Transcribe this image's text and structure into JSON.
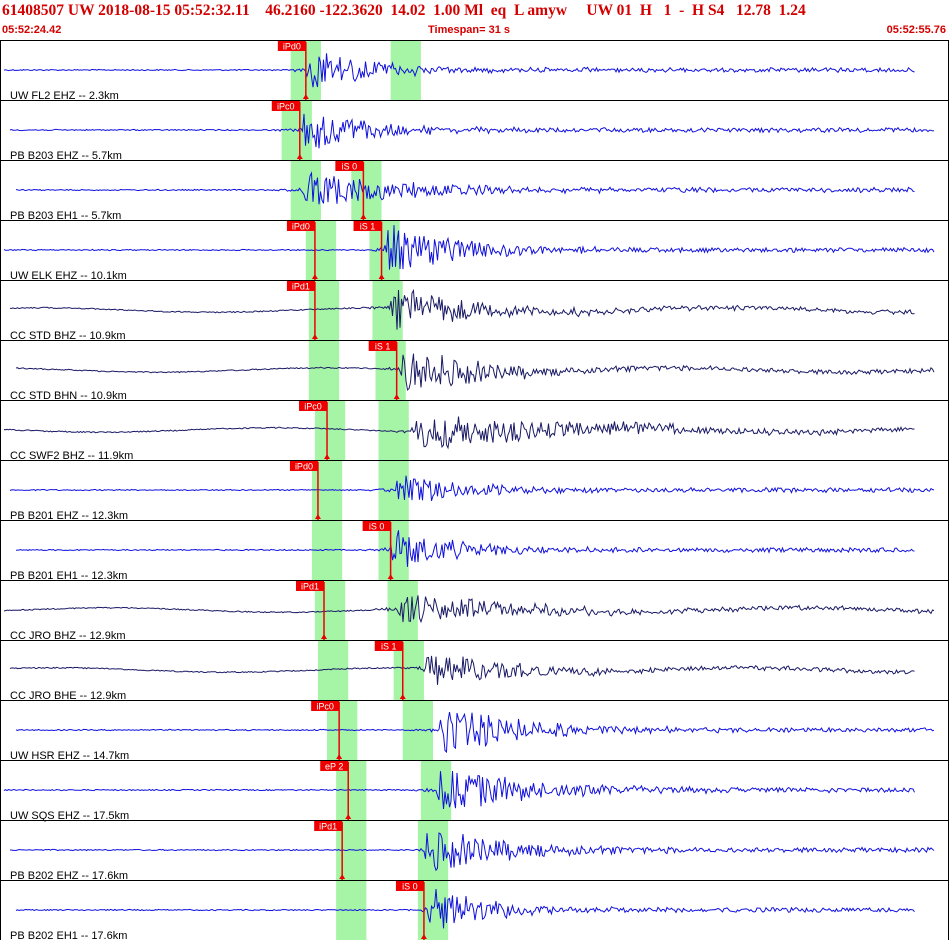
{
  "header": {
    "title": "61408507 UW 2018-08-15 05:52:32.11    46.2160 -122.3620  14.02  1.00 Ml  eq  L amyw     UW 01  H   1  -  H S4   12.78  1.24",
    "start_time": "05:52:24.42",
    "timespan": "Timespan=  31 s",
    "end_time": "05:52:55.76"
  },
  "colors": {
    "blue_trace": "#1010dd",
    "dark_trace": "#1a1a66",
    "pick": "#ee0000",
    "window": "#a6f5a6",
    "panel_border": "#000000"
  },
  "panels": [
    {
      "label": "UW FL2 EHZ -- 2.3km",
      "color": "blue",
      "picks": [
        {
          "label": "iPd0",
          "t": 10.1
        }
      ],
      "windows": [
        [
          9.6,
          10.6
        ],
        [
          12.9,
          13.9
        ]
      ],
      "amp": 1.0,
      "sig": [
        10.1,
        0.35
      ]
    },
    {
      "label": "PB B203 EHZ -- 5.7km",
      "color": "blue",
      "picks": [
        {
          "label": "iPc0",
          "t": 9.9
        }
      ],
      "windows": [
        [
          9.3,
          10.3
        ]
      ],
      "amp": 0.9,
      "sig": [
        9.9,
        0.5
      ]
    },
    {
      "label": "PB B203 EH1 -- 5.7km",
      "color": "blue",
      "picks": [
        {
          "label": "iS 0",
          "t": 12.0
        }
      ],
      "windows": [
        [
          9.6,
          10.6
        ],
        [
          11.6,
          12.6
        ]
      ],
      "amp": 0.8,
      "sig": [
        10.0,
        0.8
      ]
    },
    {
      "label": "UW ELK EHZ -- 10.1km",
      "color": "blue",
      "picks": [
        {
          "label": "iPd0",
          "t": 10.4
        },
        {
          "label": "iS 1",
          "t": 12.6
        }
      ],
      "windows": [
        [
          10.1,
          11.1
        ],
        [
          12.2,
          13.2
        ]
      ],
      "amp": 1.0,
      "sig": [
        12.7,
        0.6
      ]
    },
    {
      "label": "CC STD BHZ -- 10.9km",
      "color": "dark",
      "picks": [
        {
          "label": "iPd1",
          "t": 10.4
        }
      ],
      "windows": [
        [
          10.2,
          11.2
        ],
        [
          12.3,
          13.3
        ]
      ],
      "amp": 0.9,
      "sig": [
        12.9,
        0.7
      ]
    },
    {
      "label": "CC STD BHN -- 10.9km",
      "color": "dark",
      "picks": [
        {
          "label": "iS 1",
          "t": 13.1
        }
      ],
      "windows": [
        [
          10.2,
          11.2
        ],
        [
          12.4,
          13.4
        ]
      ],
      "amp": 1.0,
      "sig": [
        13.2,
        0.6
      ]
    },
    {
      "label": "CC SWF2 BHZ -- 11.9km",
      "color": "dark",
      "picks": [
        {
          "label": "iPc0",
          "t": 10.8
        }
      ],
      "windows": [
        [
          10.4,
          11.4
        ],
        [
          12.5,
          13.5
        ]
      ],
      "amp": 0.7,
      "sig": [
        13.6,
        1.6
      ]
    },
    {
      "label": "PB B201 EHZ -- 12.3km",
      "color": "blue",
      "picks": [
        {
          "label": "iPd0",
          "t": 10.5
        }
      ],
      "windows": [
        [
          10.3,
          11.3
        ],
        [
          12.5,
          13.5
        ]
      ],
      "amp": 0.7,
      "sig": [
        13.0,
        0.5
      ]
    },
    {
      "label": "PB B201 EH1 -- 12.3km",
      "color": "blue",
      "picks": [
        {
          "label": "iS 0",
          "t": 12.9
        }
      ],
      "windows": [
        [
          10.3,
          11.3
        ],
        [
          12.5,
          13.5
        ]
      ],
      "amp": 0.9,
      "sig": [
        12.9,
        0.45
      ]
    },
    {
      "label": "CC JRO BHZ -- 12.9km",
      "color": "dark",
      "picks": [
        {
          "label": "iPd1",
          "t": 10.7
        }
      ],
      "windows": [
        [
          10.4,
          11.4
        ],
        [
          12.8,
          13.8
        ]
      ],
      "amp": 0.7,
      "sig": [
        13.1,
        0.9
      ]
    },
    {
      "label": "CC JRO BHE -- 12.9km",
      "color": "dark",
      "picks": [
        {
          "label": "iS 1",
          "t": 13.3
        }
      ],
      "windows": [
        [
          10.5,
          11.5
        ],
        [
          13.0,
          14.0
        ]
      ],
      "amp": 0.8,
      "sig": [
        14.0,
        0.6
      ]
    },
    {
      "label": "UW HSR EHZ -- 14.7km",
      "color": "blue",
      "picks": [
        {
          "label": "iPc0",
          "t": 11.2
        }
      ],
      "windows": [
        [
          10.8,
          11.8
        ],
        [
          13.3,
          14.3
        ]
      ],
      "amp": 1.0,
      "sig": [
        14.5,
        0.6
      ]
    },
    {
      "label": "UW SQS EHZ -- 17.5km",
      "color": "blue",
      "picks": [
        {
          "label": "eP 2",
          "t": 11.5
        }
      ],
      "windows": [
        [
          11.1,
          12.1
        ],
        [
          13.9,
          14.9
        ]
      ],
      "amp": 0.9,
      "sig": [
        14.4,
        0.8
      ]
    },
    {
      "label": "PB B202 EHZ -- 17.6km",
      "color": "blue",
      "picks": [
        {
          "label": "iPd1",
          "t": 11.3
        }
      ],
      "windows": [
        [
          11.1,
          12.1
        ],
        [
          13.8,
          14.8
        ]
      ],
      "amp": 0.9,
      "sig": [
        14.0,
        0.7
      ]
    },
    {
      "label": "PB B202 EH1 -- 17.6km",
      "color": "blue",
      "picks": [
        {
          "label": "iS 0",
          "t": 14.0
        }
      ],
      "windows": [
        [
          11.1,
          12.1
        ],
        [
          13.8,
          14.8
        ]
      ],
      "amp": 1.0,
      "sig": [
        14.1,
        0.4
      ]
    }
  ]
}
